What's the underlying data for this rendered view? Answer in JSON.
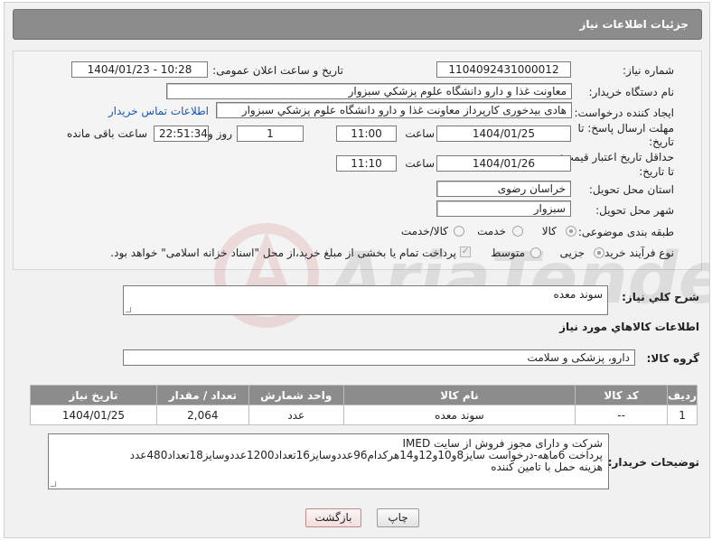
{
  "header": {
    "title": "جزئیات اطلاعات نیاز"
  },
  "fields": {
    "need_number_label": "شماره نیاز:",
    "need_number": "1104092431000012",
    "announce_label": "تاریخ و ساعت اعلان عمومی:",
    "announce_value": "1404/01/23 - 10:28",
    "buyer_org_label": "نام دستگاه خریدار:",
    "buyer_org": "معاونت غذا و دارو   دانشگاه علوم پزشکي سبزوار",
    "creator_label": "ایجاد کننده درخواست:",
    "creator": "هادی بیدخوری کارپرداز معاونت غذا و دارو   دانشگاه علوم پزشکي سبزوار",
    "buyer_contact_link": "اطلاعات تماس خریدار",
    "deadline_label_1": "مهلت ارسال پاسخ: تا",
    "deadline_label_2": "تاریخ:",
    "deadline_date": "1404/01/25",
    "time_label": "ساعت",
    "deadline_time": "11:00",
    "days_value": "1",
    "days_label": "روز و",
    "remaining_value": "22:51:34",
    "remaining_label": "ساعت باقی مانده",
    "min_validity_label_1": "حداقل تاریخ اعتبار قیمت:",
    "min_validity_label_2": "تا تاریخ:",
    "validity_date": "1404/01/26",
    "validity_time": "11:10",
    "province_label": "استان محل تحویل:",
    "province": "خراسان رضوی",
    "city_label": "شهر محل تحویل:",
    "city": "سبزوار",
    "category_label": "طبقه بندی موضوعی:",
    "category_options": [
      "کالا",
      "خدمت",
      "کالا/خدمت"
    ],
    "category_selected": "کالا",
    "process_label": "نوع فرآیند خرید :",
    "process_options": [
      "جزیی",
      "متوسط"
    ],
    "process_selected": "جزیی",
    "payment_note": "پرداخت تمام یا بخشی از مبلغ خرید،از محل \"اسناد خزانه اسلامی\" خواهد بود."
  },
  "description": {
    "label": "شرح کلي نياز:",
    "value": "سوند معده"
  },
  "goods_info_title": "اطلاعات کالاهاي مورد نياز",
  "goods_group": {
    "label": "گروه کالا:",
    "value": "دارو، پزشکی و سلامت"
  },
  "table": {
    "headers": [
      "رديف",
      "کد کالا",
      "نام کالا",
      "واحد شمارش",
      "تعداد / مقدار",
      "تاریخ نیاز"
    ],
    "rows": [
      [
        "1",
        "--",
        "سوند معده",
        "عدد",
        "2,064",
        "1404/01/25"
      ]
    ]
  },
  "buyer_notes": {
    "label": "توضیحات خریدار:",
    "value": "شرکت و دارای مجوز فروش از سایت IMED\nپرداخت 6ماهه-درخواست سایز8و10و12و14هرکدام96عددوسایز16تعداد1200عددوسایز18تعداد480عدد\nهزینه حمل با تامین کننده"
  },
  "buttons": {
    "print": "چاپ",
    "back": "بازگشت"
  },
  "colors": {
    "header_bg": "#8c8c8c",
    "link": "#1a55b5"
  }
}
